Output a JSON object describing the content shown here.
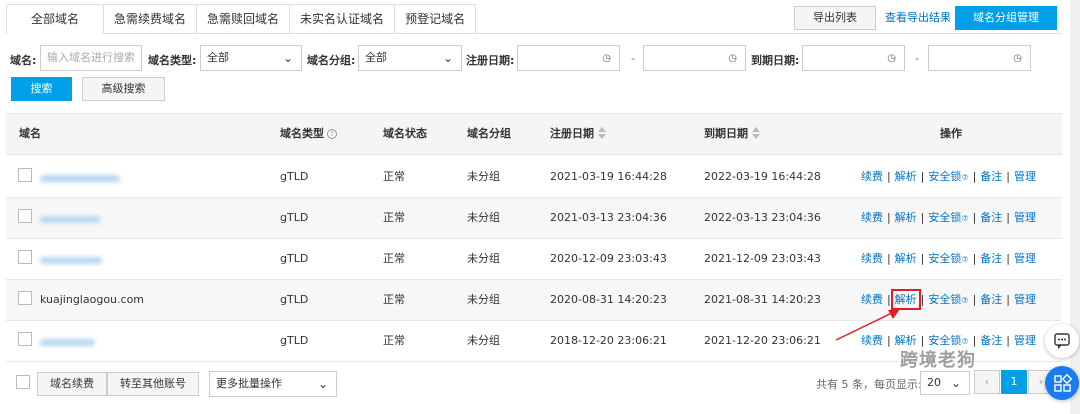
{
  "tabs": [
    "全部域名",
    "急需续费域名",
    "急需赎回域名",
    "未实名认证域名",
    "预登记域名"
  ],
  "header": {
    "export_list": "导出列表",
    "view_export": "查看导出结果",
    "group_manage": "域名分组管理"
  },
  "filters": {
    "domain_label": "域名:",
    "domain_placeholder": "输入域名进行搜索",
    "type_label": "域名类型:",
    "type_value": "全部",
    "group_label": "域名分组:",
    "group_value": "全部",
    "reg_label": "注册日期:",
    "exp_label": "到期日期:",
    "dash": "-",
    "search": "搜索",
    "advanced": "高级搜索"
  },
  "table": {
    "headers": {
      "domain": "域名",
      "type": "域名类型",
      "status": "域名状态",
      "group": "域名分组",
      "reg": "注册日期",
      "exp": "到期日期",
      "ops": "操作"
    },
    "ops": {
      "renew": "续费",
      "resolve": "解析",
      "lock": "安全锁",
      "note": "备注",
      "manage": "管理",
      "sep": "|"
    },
    "rows": [
      {
        "domain": "",
        "type": "gTLD",
        "status": "正常",
        "group": "未分组",
        "reg": "2021-03-19 16:44:28",
        "exp": "2022-03-19 16:44:28"
      },
      {
        "domain": "",
        "type": "gTLD",
        "status": "正常",
        "group": "未分组",
        "reg": "2021-03-13 23:04:36",
        "exp": "2022-03-13 23:04:36"
      },
      {
        "domain": "",
        "type": "gTLD",
        "status": "正常",
        "group": "未分组",
        "reg": "2020-12-09 23:03:43",
        "exp": "2021-12-09 23:03:43"
      },
      {
        "domain": "kuajinglaogou.com",
        "type": "gTLD",
        "status": "正常",
        "group": "未分组",
        "reg": "2020-08-31 14:20:23",
        "exp": "2021-08-31 14:20:23"
      },
      {
        "domain": "",
        "type": "gTLD",
        "status": "正常",
        "group": "未分组",
        "reg": "2018-12-20 23:06:21",
        "exp": "2021-12-20 23:06:21"
      }
    ]
  },
  "footer": {
    "renew": "域名续费",
    "transfer": "转至其他账号",
    "more": "更多批量操作",
    "summary": "共有 5 条，每页显示:",
    "page_size": "20",
    "prev": "‹",
    "page": "1",
    "next": "›"
  },
  "watermark": "跨境老狗",
  "colors": {
    "accent": "#00a0e9",
    "link": "#0073c6",
    "highlight": "#e02020"
  }
}
